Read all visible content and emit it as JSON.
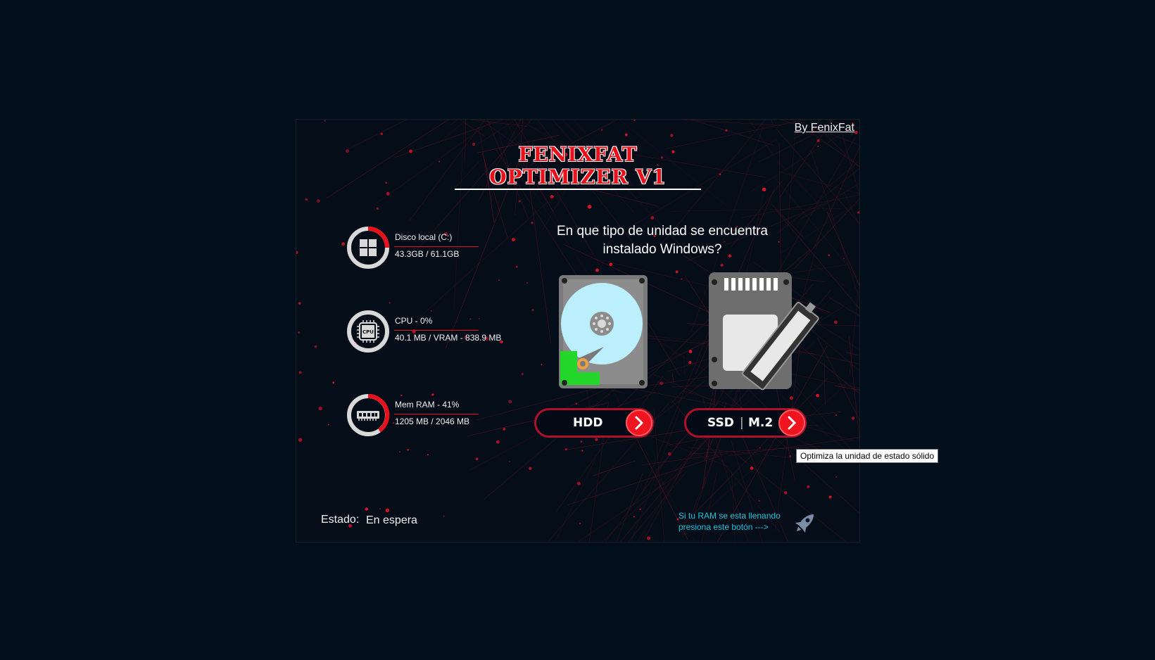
{
  "window": {
    "title": "FENIXFAT OPTIMIZER V1",
    "author_link": "By FenixFat"
  },
  "stats": [
    {
      "label": "Disco local (C:)",
      "value": "43.3GB / 61.1GB",
      "icon": "windows-logo-icon",
      "fill": 0.25
    },
    {
      "label": "CPU - 0%",
      "value": "40.1 MB / VRAM - 838.9 MB",
      "icon": "cpu-chip-icon",
      "fill": 0.0
    },
    {
      "label": "Mem RAM - 41%",
      "value": "1205 MB / 2046 MB",
      "icon": "ram-module-icon",
      "fill": 0.41
    }
  ],
  "question": "En que tipo de unidad se encuentra instalado Windows?",
  "drives": {
    "hdd": {
      "label": "HDD",
      "icon": "hard-disk-drive-icon"
    },
    "ssd": {
      "label_left": "SSD",
      "label_right": "M.2",
      "icon": "ssd-m2-icon"
    }
  },
  "status": {
    "label": "Estado:",
    "value": "En espera"
  },
  "ram_hint": {
    "line1": "Si tu RAM se esta llenando",
    "line2": "presiona este botón --->",
    "icon": "rocket-icon"
  },
  "tooltip": "Optimiza la unidad de estado sólido",
  "colors": {
    "background": "#020f1b",
    "accent": "#e8101a",
    "hint": "#15c8dc",
    "panel": "#050d19"
  }
}
